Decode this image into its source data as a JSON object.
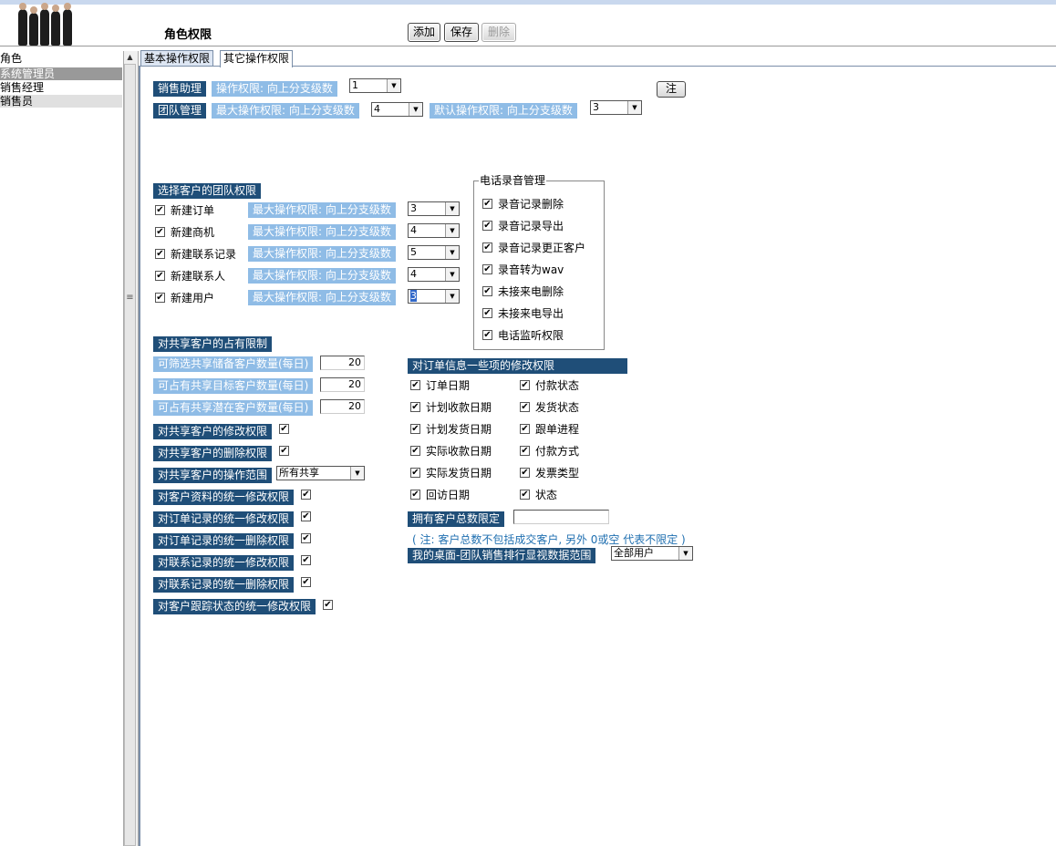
{
  "header": {
    "title": "角色权限",
    "buttons": {
      "add": "添加",
      "save": "保存",
      "delete": "删除"
    }
  },
  "roles": {
    "header": "角色",
    "items": [
      "系统管理员",
      "销售经理",
      "销售员"
    ]
  },
  "tabs": [
    "基本操作权限",
    "其它操作权限"
  ],
  "top_section": {
    "sales_assistant": {
      "label": "销售助理",
      "perm_label": "操作权限: 向上分支级数",
      "value": "1"
    },
    "team_mgmt": {
      "label": "团队管理",
      "max_label": "最大操作权限: 向上分支级数",
      "max_value": "4",
      "default_label": "默认操作权限: 向上分支级数",
      "default_value": "3"
    },
    "note_button": "注"
  },
  "team_section": {
    "title": "选择客户的团队权限",
    "rows": [
      {
        "label": "新建订单",
        "perm_label": "最大操作权限: 向上分支级数",
        "value": "3"
      },
      {
        "label": "新建商机",
        "perm_label": "最大操作权限: 向上分支级数",
        "value": "4"
      },
      {
        "label": "新建联系记录",
        "perm_label": "最大操作权限: 向上分支级数",
        "value": "5"
      },
      {
        "label": "新建联系人",
        "perm_label": "最大操作权限: 向上分支级数",
        "value": "4"
      },
      {
        "label": "新建用户",
        "perm_label": "最大操作权限: 向上分支级数",
        "value": "3"
      }
    ]
  },
  "phone_section": {
    "legend": "电话录音管理",
    "items": [
      "录音记录删除",
      "录音记录导出",
      "录音记录更正客户",
      "录音转为wav",
      "未接来电删除",
      "未接来电导出",
      "电话监听权限"
    ]
  },
  "shared_section": {
    "title": "对共享客户的占有限制",
    "limits": [
      {
        "label": "可筛选共享储备客户数量(每日)",
        "value": "20"
      },
      {
        "label": "可占有共享目标客户数量(每日)",
        "value": "20"
      },
      {
        "label": "可占有共享潜在客户数量(每日)",
        "value": "20"
      }
    ],
    "perms": [
      {
        "label": "对共享客户的修改权限",
        "checked": true
      },
      {
        "label": "对共享客户的删除权限",
        "checked": true
      }
    ],
    "scope_label": "对共享客户的操作范围",
    "scope_value": "所有共享",
    "unified": [
      {
        "label": "对客户资料的统一修改权限",
        "checked": true
      },
      {
        "label": "对订单记录的统一修改权限",
        "checked": true
      },
      {
        "label": "对订单记录的统一删除权限",
        "checked": true
      },
      {
        "label": "对联系记录的统一修改权限",
        "checked": true
      },
      {
        "label": "对联系记录的统一删除权限",
        "checked": true
      },
      {
        "label": "对客户跟踪状态的统一修改权限",
        "checked": true
      }
    ]
  },
  "order_section": {
    "title": "对订单信息一些项的修改权限",
    "left_items": [
      "订单日期",
      "计划收款日期",
      "计划发货日期",
      "实际收款日期",
      "实际发货日期",
      "回访日期"
    ],
    "right_items": [
      "付款状态",
      "发货状态",
      "跟单进程",
      "付款方式",
      "发票类型",
      "状态"
    ],
    "total_label": "拥有客户总数限定",
    "total_value": "",
    "note": "( 注: 客户总数不包括成交客户, 另外 0或空 代表不限定 )",
    "desktop_label": "我的桌面-团队销售排行显视数据范围",
    "desktop_value": "全部用户"
  },
  "check_mark": "✔",
  "dropdown_arrow": "▼",
  "colors": {
    "section_dark": "#1f4e78",
    "section_light": "#8fbce6",
    "role_selected": "#999999",
    "role_highlight": "#e0e0e0"
  }
}
